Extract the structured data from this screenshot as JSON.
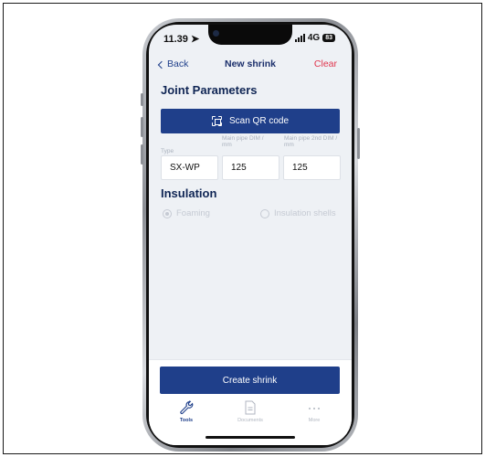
{
  "status_bar": {
    "time": "11.39",
    "network": "4G",
    "battery": "83"
  },
  "nav": {
    "back_label": "Back",
    "title": "New shrink",
    "clear_label": "Clear"
  },
  "joint": {
    "title": "Joint Parameters",
    "scan_label": "Scan QR code",
    "fields": [
      {
        "label": "Type",
        "value": "SX-WP"
      },
      {
        "label": "Main pipe DIM / mm",
        "value": "125"
      },
      {
        "label": "Main pipe 2nd DIM / mm",
        "value": "125"
      }
    ]
  },
  "insulation": {
    "title": "Insulation",
    "options": [
      {
        "label": "Foaming",
        "selected": true
      },
      {
        "label": "Insulation shells",
        "selected": false
      }
    ]
  },
  "create_label": "Create shrink",
  "tabs": [
    {
      "label": "Tools",
      "icon": "wrench-icon",
      "active": true
    },
    {
      "label": "Documents",
      "icon": "document-icon",
      "active": false
    },
    {
      "label": "More",
      "icon": "more-icon",
      "active": false
    }
  ],
  "colors": {
    "primary": "#1f3f8a",
    "danger": "#e0344c",
    "background": "#eef1f5",
    "disabled": "#c5cad3"
  }
}
